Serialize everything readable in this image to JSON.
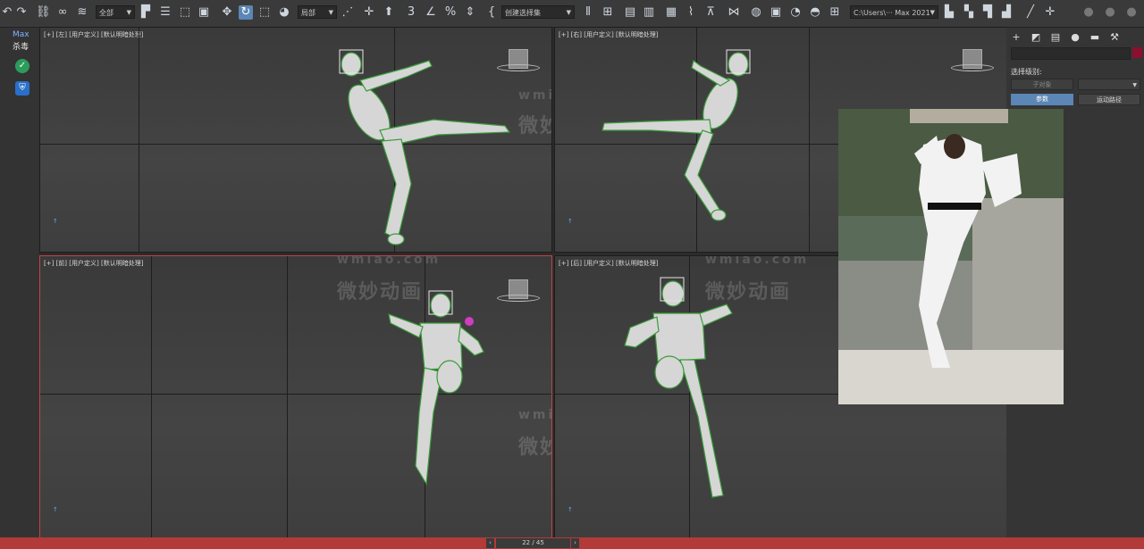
{
  "toolbar": {
    "selection_filter": "全部",
    "reference_coord": "局部",
    "named_selection": "创建选择集",
    "project_path": "C:\\Users\\··· Max 2021"
  },
  "left_strip": {
    "brand": "Max",
    "antivirus": "杀毒"
  },
  "viewports": {
    "top_left": {
      "bracket": "[+]",
      "view": "[左]",
      "shading": "[用户定义]",
      "lighting": "[默认明暗处理]"
    },
    "top_right": {
      "bracket": "[+]",
      "view": "[右]",
      "shading": "[用户定义]",
      "lighting": "[默认明暗处理]"
    },
    "bottom_left": {
      "bracket": "[+]",
      "view": "[前]",
      "shading": "[用户定义]",
      "lighting": "[默认明暗处理]"
    },
    "bottom_right": {
      "bracket": "[+]",
      "view": "[后]",
      "shading": "[用户定义]",
      "lighting": "[默认明暗处理]"
    }
  },
  "watermark": {
    "url": "wmiao.com",
    "brand": "微妙动画"
  },
  "command_panel": {
    "selection_level_label": "选择级别:",
    "sub_object_button": "子对象",
    "params_button": "参数",
    "motion_path_button": "运动路径"
  },
  "timeline": {
    "frame_counter": "22 / 45"
  },
  "colors": {
    "active_viewport_border": "#c0434a",
    "status_bar": "#b23a38",
    "accent_button": "#5b86b5"
  }
}
